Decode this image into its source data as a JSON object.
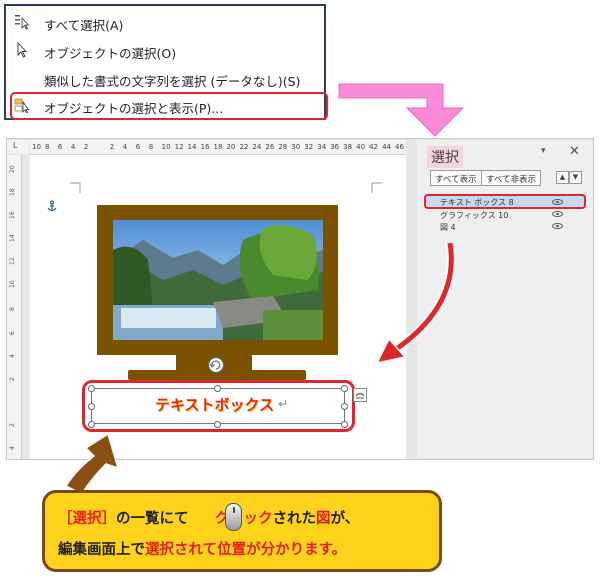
{
  "context_menu": {
    "items": [
      {
        "label": "すべて選択(A)",
        "icon": "select-all-icon"
      },
      {
        "label": "オブジェクトの選択(O)",
        "icon": "cursor-arrow-icon"
      },
      {
        "label": "類似した書式の文字列を選択 (データなし)(S)",
        "icon": ""
      },
      {
        "label": "オブジェクトの選択と表示(P)...",
        "icon": "selection-pane-icon"
      }
    ]
  },
  "ruler": {
    "corner": "L",
    "top_ticks": [
      "10",
      "8",
      "6",
      "4",
      "2",
      "",
      "2",
      "4",
      "6",
      "8",
      "10",
      "12",
      "14",
      "16",
      "18",
      "20",
      "22",
      "24",
      "26",
      "28",
      "30",
      "32",
      "34",
      "36",
      "38",
      "40",
      "42",
      "44",
      "46"
    ],
    "left_ticks": [
      "20",
      "18",
      "16",
      "14",
      "12",
      "10",
      "8",
      "6",
      "4",
      "2",
      "",
      "2",
      "4"
    ]
  },
  "selection_pane": {
    "title": "選択",
    "show_all": "すべて表示",
    "hide_all": "すべて非表示",
    "items": [
      "テキスト ボックス 8",
      "グラフィックス 10",
      "図 4"
    ],
    "highlight_color": "#f6d3dd"
  },
  "document": {
    "textbox_text": "テキストボックス",
    "paragraph_mark": "↵"
  },
  "callout": {
    "line1": [
      {
        "text": "［選択］",
        "red": true
      },
      {
        "text": "の一覧にて",
        "red": false
      },
      {
        "text": "クリック",
        "red": true
      },
      {
        "text": "された",
        "red": false
      },
      {
        "text": "図",
        "red": true
      },
      {
        "text": "が、",
        "red": false
      }
    ],
    "line2": [
      {
        "text": "編集画面上で",
        "red": false
      },
      {
        "text": "選択されて位置が分かります。",
        "red": true
      }
    ]
  },
  "colors": {
    "accent_red": "#e0252b",
    "tv_brown": "#7a5200",
    "callout_yellow": "#ffd21c",
    "arrow_pink": "#f98bd8"
  }
}
